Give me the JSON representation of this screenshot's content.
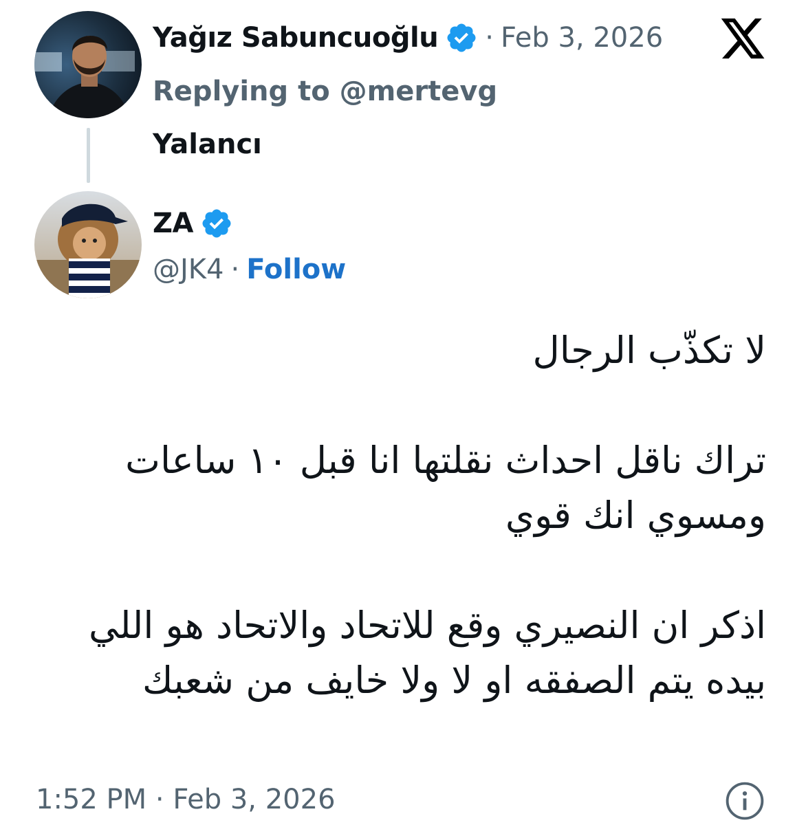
{
  "reply": {
    "author_name": "Yağız Sabuncuoğlu",
    "separator": "·",
    "date": "Feb 3, 2026",
    "replying_to": "Replying to @mertevg",
    "text": "Yalancı",
    "verified_icon": "verified-badge-icon"
  },
  "quoted": {
    "author_name": "ZA",
    "handle": "@JK4",
    "separator": "·",
    "follow_label": "Follow",
    "lines": [
      "لا تكذّب الرجال",
      "تراك ناقل احداث نقلتها انا قبل ١٠ ساعات ومسوي انك قوي",
      "اذكر ان النصيري وقع للاتحاد والاتحاد هو اللي بيده يتم الصفقه او لا ولا خايف من شعبك"
    ],
    "timestamp": "1:52 PM · Feb 3, 2026"
  },
  "colors": {
    "verified": "#1d9bf0",
    "follow": "#1d72c9",
    "muted": "#536471",
    "text": "#0f1419",
    "thread_line": "#cfd9de"
  },
  "icons": {
    "brand": "x-logo-icon",
    "info": "info-icon"
  }
}
